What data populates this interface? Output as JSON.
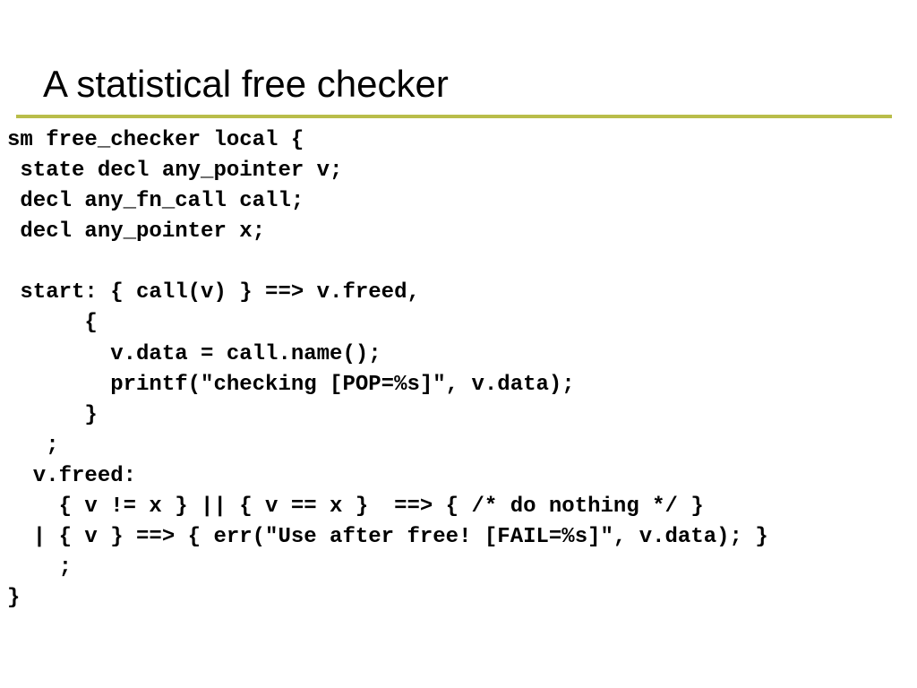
{
  "slide": {
    "title": "A statistical free checker",
    "code": "sm free_checker local {\n state decl any_pointer v;\n decl any_fn_call call;\n decl any_pointer x;\n\n start: { call(v) } ==> v.freed,\n      {\n        v.data = call.name();\n        printf(\"checking [POP=%s]\", v.data);\n      }\n   ;\n  v.freed:\n    { v != x } || { v == x }  ==> { /* do nothing */ }\n  | { v } ==> { err(\"Use after free! [FAIL=%s]\", v.data); }\n    ;\n}"
  }
}
